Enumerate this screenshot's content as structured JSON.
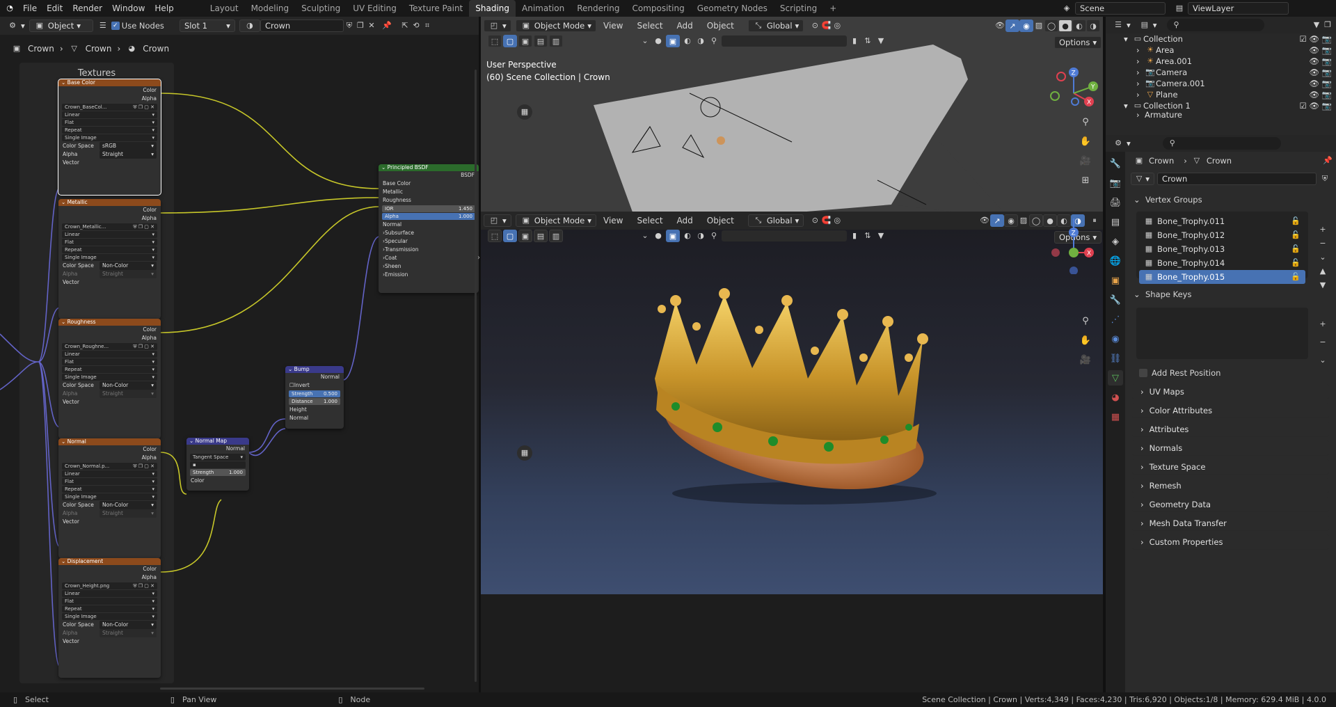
{
  "menubar": {
    "items": [
      "File",
      "Edit",
      "Render",
      "Window",
      "Help"
    ],
    "workspaces": [
      "Layout",
      "Modeling",
      "Sculpting",
      "UV Editing",
      "Texture Paint",
      "Shading",
      "Animation",
      "Rendering",
      "Compositing",
      "Geometry Nodes",
      "Scripting"
    ],
    "active_workspace": "Shading",
    "scene": "Scene",
    "view_layer": "ViewLayer"
  },
  "node_editor": {
    "header": {
      "object_mode": "Object",
      "use_nodes": "Use Nodes",
      "slot": "Slot 1",
      "material": "Crown"
    },
    "breadcrumb": [
      "Crown",
      "Crown",
      "Crown"
    ],
    "frame_label": "Textures",
    "textures": [
      {
        "title": "Base Color",
        "image": "Crown_BaseCol...",
        "interp": "Linear",
        "proj": "Flat",
        "ext": "Repeat",
        "source": "Single Image",
        "color_space": "sRGB",
        "alpha": "Straight"
      },
      {
        "title": "Metallic",
        "image": "Crown_Metallic...",
        "interp": "Linear",
        "proj": "Flat",
        "ext": "Repeat",
        "source": "Single Image",
        "color_space": "Non-Color",
        "alpha": "Straight"
      },
      {
        "title": "Roughness",
        "image": "Crown_Roughne...",
        "interp": "Linear",
        "proj": "Flat",
        "ext": "Repeat",
        "source": "Single Image",
        "color_space": "Non-Color",
        "alpha": "Straight"
      },
      {
        "title": "Normal",
        "image": "Crown_Normal.p...",
        "interp": "Linear",
        "proj": "Flat",
        "ext": "Repeat",
        "source": "Single Image",
        "color_space": "Non-Color",
        "alpha": "Straight"
      },
      {
        "title": "Displacement",
        "image": "Crown_Height.png",
        "interp": "Linear",
        "proj": "Flat",
        "ext": "Repeat",
        "source": "Single Image",
        "color_space": "Non-Color",
        "alpha": "Straight"
      }
    ],
    "labels": {
      "color": "Color",
      "alpha": "Alpha",
      "vector": "Vector",
      "color_space": "Color Space",
      "alpha_lbl": "Alpha",
      "normal": "Normal",
      "height": "Height",
      "distance": "Distance",
      "strength": "Strength",
      "invert": "Invert"
    },
    "bsdf": {
      "title": "Principled BSDF",
      "out": "BSDF",
      "inputs": [
        "Base Color",
        "Metallic",
        "Roughness"
      ],
      "ior_label": "IOR",
      "ior": "1.450",
      "alpha_label": "Alpha",
      "alpha": "1.000",
      "normal": "Normal",
      "panels": [
        "Subsurface",
        "Specular",
        "Transmission",
        "Coat",
        "Sheen",
        "Emission"
      ]
    },
    "bump": {
      "title": "Bump",
      "out": "Normal",
      "strength": "0.500",
      "distance": "1.000"
    },
    "normal_map": {
      "title": "Normal Map",
      "out": "Normal",
      "space": "Tangent Space",
      "strength": "1.000"
    }
  },
  "viewport_top": {
    "mode": "Object Mode",
    "menus": [
      "View",
      "Select",
      "Add",
      "Object"
    ],
    "orientation": "Global",
    "options": "Options",
    "perspective": "User Perspective",
    "collection": "(60) Scene Collection | Crown"
  },
  "viewport_bottom": {
    "mode": "Object Mode",
    "menus": [
      "View",
      "Select",
      "Add",
      "Object"
    ],
    "orientation": "Global",
    "options": "Options"
  },
  "outliner": {
    "collection": "Collection",
    "items": [
      "Area",
      "Area.001",
      "Camera",
      "Camera.001",
      "Plane"
    ],
    "collection2": "Collection 1",
    "partial": "Armature"
  },
  "properties": {
    "breadcrumb": [
      "Crown",
      "Crown"
    ],
    "mesh_name": "Crown",
    "vertex_groups_label": "Vertex Groups",
    "vertex_groups": [
      "Bone_Trophy.011",
      "Bone_Trophy.012",
      "Bone_Trophy.013",
      "Bone_Trophy.014",
      "Bone_Trophy.015"
    ],
    "selected_group": "Bone_Trophy.015",
    "shape_keys_label": "Shape Keys",
    "rest_position": "Add Rest Position",
    "panels": [
      "UV Maps",
      "Color Attributes",
      "Attributes",
      "Normals",
      "Texture Space",
      "Remesh",
      "Geometry Data",
      "Mesh Data Transfer",
      "Custom Properties"
    ]
  },
  "status": {
    "select": "Select",
    "pan": "Pan View",
    "node": "Node",
    "info": "Scene Collection | Crown | Verts:4,349 | Faces:4,230 | Tris:6,920 | Objects:1/8 | Memory: 629.4 MiB | 4.0.0"
  },
  "colors": {
    "accent": "#4772b3",
    "texture_header": "#8c4a1c",
    "bsdf_header": "#2b6b2b",
    "vector_header": "#3a3a8a"
  }
}
